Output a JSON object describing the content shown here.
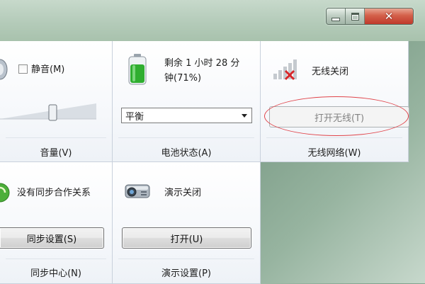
{
  "window": {
    "caption_buttons": {
      "minimize_icon": "minimize-icon",
      "maximize_icon": "maximize-icon",
      "close_glyph": "✕"
    }
  },
  "volume": {
    "mute_label": "静音(M)",
    "mute_checked": false,
    "slider_level": 0.55,
    "title": "音量(V)"
  },
  "battery": {
    "status_text_line1": "剩余 1 小时 28 分",
    "status_text_line2": "钟(71%)",
    "charge_percent": 71,
    "plan_value": "平衡",
    "title": "电池状态(A)"
  },
  "wireless": {
    "status_text": "无线关闭",
    "toggle_button_label": "打开无线(T)",
    "title": "无线网络(W)"
  },
  "sync": {
    "status_text": "没有同步合作关系",
    "button_label": "同步设置(S)",
    "title": "同步中心(N)"
  },
  "presentation": {
    "status_text": "演示关闭",
    "button_label": "打开(U)",
    "title": "演示设置(P)"
  },
  "colors": {
    "battery_green": "#2fae2f",
    "highlight_red": "#e0444a",
    "close_red": "#c0392b"
  }
}
